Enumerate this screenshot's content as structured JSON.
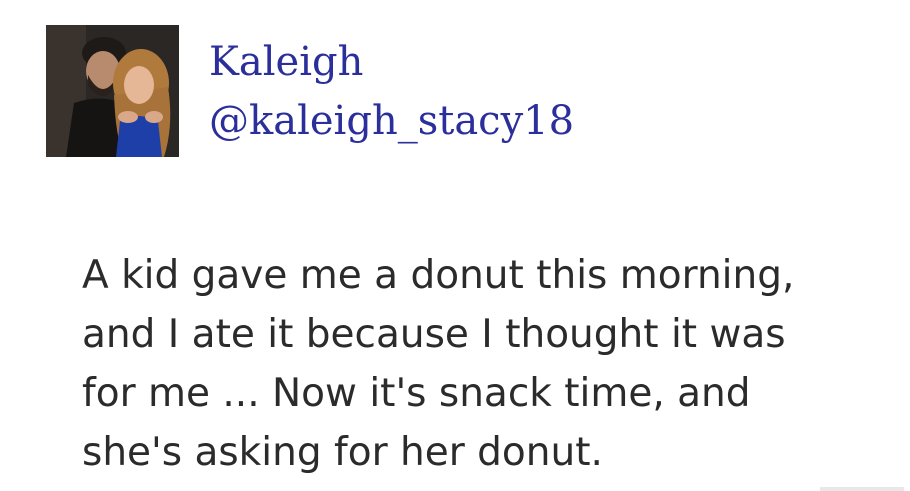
{
  "user": {
    "display_name": "Kaleigh",
    "handle": "@kaleigh_stacy18",
    "avatar_icon": "profile-photo"
  },
  "tweet": {
    "lines": [
      "A kid gave me a donut this morning,",
      "and I ate it because I thought it was",
      "for me ... Now it's snack time, and",
      "she's asking for her donut."
    ]
  },
  "colors": {
    "name": "#2b2f9c",
    "text": "#2b2b2b",
    "background": "#ffffff"
  }
}
